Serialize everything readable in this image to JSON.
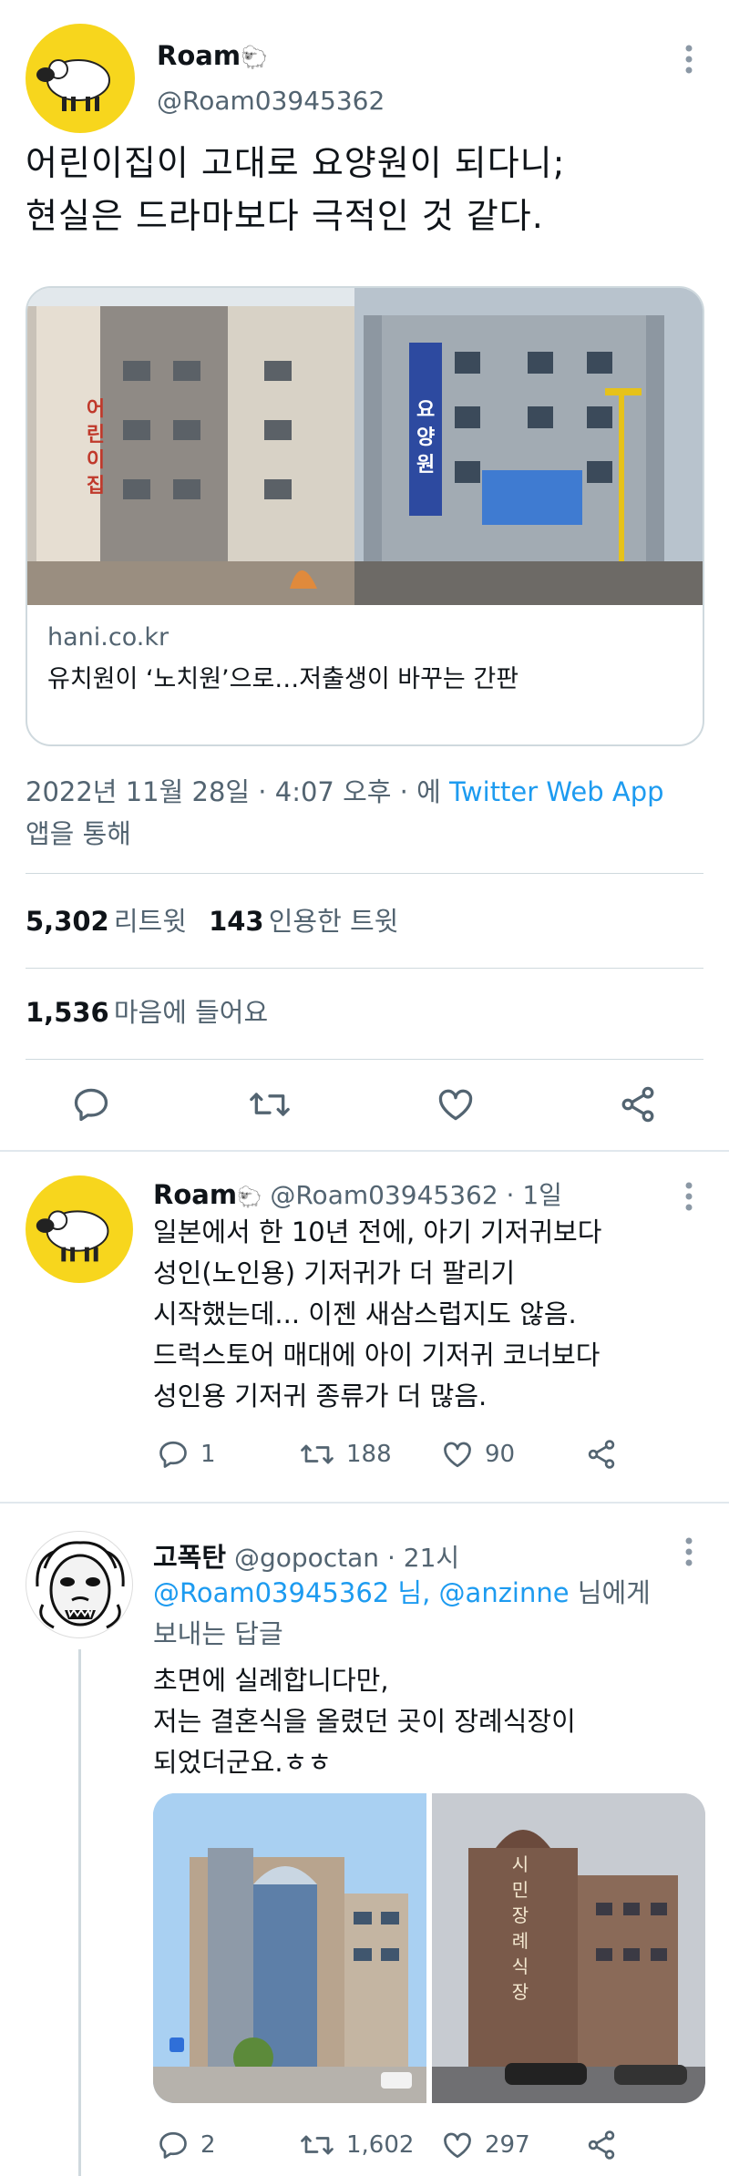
{
  "main_tweet": {
    "author_name": "Roam",
    "author_emoji": "🐑",
    "author_handle": "@Roam03945362",
    "text_line1": "어린이집이 고대로 요양원이 되다니;",
    "text_line2": "현실은 드라마보다 극적인 것 같다.",
    "card": {
      "domain": "hani.co.kr",
      "headline": "유치원이 ‘노치원’으로…저출생이 바꾸는 간판",
      "left_sign": "어린이집",
      "right_sign": "요양원"
    },
    "date": "2022년 11월 28일 · 4:07 오후 · 에 ",
    "source": "Twitter Web App",
    "source_suffix": "앱을 통해",
    "retweets_count": "5,302",
    "retweets_label": "리트윗",
    "quotes_count": "143",
    "quotes_label": "인용한 트윗",
    "likes_count": "1,536",
    "likes_label": "마음에 들어요"
  },
  "reply1": {
    "author_name": "Roam",
    "author_emoji": "🐑",
    "author_handle": "@Roam03945362",
    "time": "· 1일",
    "lines": [
      "일본에서 한 10년 전에, 아기 기저귀보다",
      "성인(노인용) 기저귀가 더 팔리기",
      "시작했는데... 이젠 새삼스럽지도 않음.",
      "드럭스토어 매대에 아이 기저귀 코너보다",
      "성인용 기저귀 종류가 더 많음."
    ],
    "replies": "1",
    "retweets": "188",
    "likes": "90"
  },
  "reply2": {
    "author_name": "고폭탄",
    "author_handle": "@gopoctan",
    "time": "· 21시",
    "reply_to_handles": "@Roam03945362 님, @anzinne",
    "reply_to_suffix": " 님에게",
    "reply_to_line2": "보내는 답글",
    "lines": [
      "초면에 실례합니다만,",
      "저는 결혼식을 올렸던 곳이 장례식장이",
      "되었더군요.ㅎㅎ"
    ],
    "right_sign": "시민장례식장",
    "replies": "2",
    "retweets": "1,602",
    "likes": "297"
  },
  "colors": {
    "link": "#1d9bf0",
    "secondary_text": "#536471",
    "avatar_yellow": "#f7d61d"
  },
  "icons": [
    "more-icon",
    "reply-icon",
    "retweet-icon",
    "like-icon",
    "share-icon"
  ]
}
